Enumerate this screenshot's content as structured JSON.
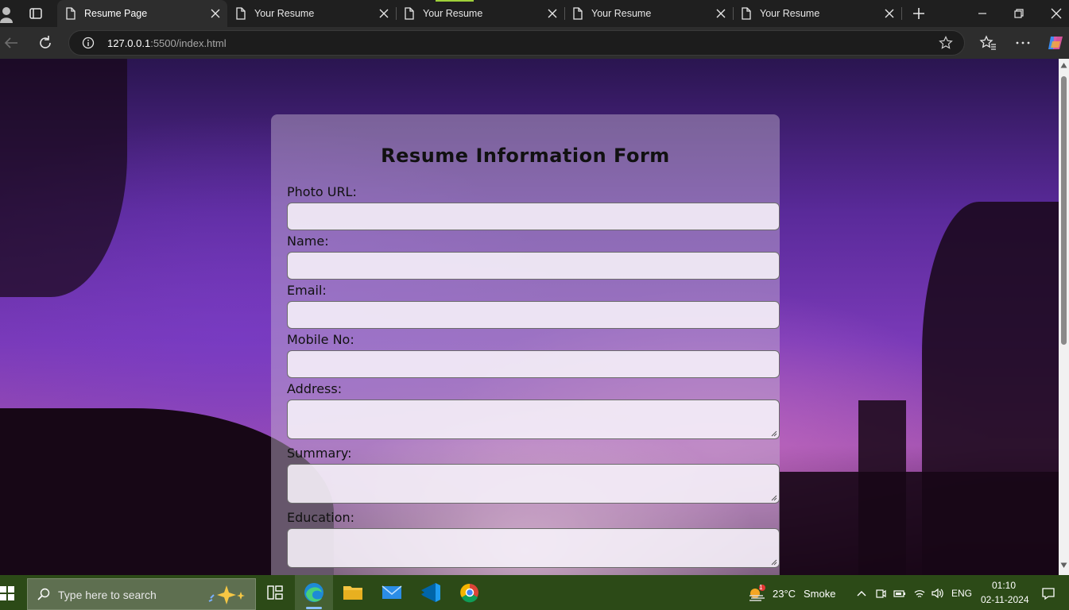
{
  "browser": {
    "tabs": [
      {
        "title": "Resume Page",
        "active": true
      },
      {
        "title": "Your Resume",
        "active": false
      },
      {
        "title": "Your Resume",
        "active": false
      },
      {
        "title": "Your Resume",
        "active": false
      },
      {
        "title": "Your Resume",
        "active": false
      }
    ],
    "url_host": "127.0.0.1",
    "url_rest": ":5500/index.html"
  },
  "form": {
    "title": "Resume Information Form",
    "fields": [
      {
        "label": "Photo URL:",
        "type": "input"
      },
      {
        "label": "Name:",
        "type": "input"
      },
      {
        "label": "Email:",
        "type": "input"
      },
      {
        "label": "Mobile No:",
        "type": "input"
      },
      {
        "label": "Address:",
        "type": "textarea"
      },
      {
        "label": "Summary:",
        "type": "textarea"
      },
      {
        "label": "Education:",
        "type": "textarea"
      }
    ]
  },
  "taskbar": {
    "search_placeholder": "Type here to search",
    "weather_temp": "23°C",
    "weather_desc": "Smoke",
    "weather_badge": "1",
    "language": "ENG",
    "time": "01:10",
    "date": "02-11-2024"
  },
  "colors": {
    "accent_tab_marker": "#9fd13a",
    "taskbar": "#2c4a17"
  }
}
